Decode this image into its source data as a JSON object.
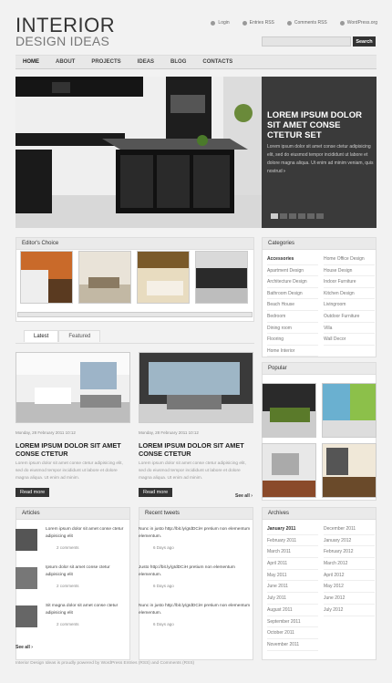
{
  "logo": {
    "line1": "INTERIOR",
    "line2": "DESIGN IDEAS"
  },
  "toplinks": [
    "Login",
    "Entries RSS",
    "Comments RSS",
    "WordPress.org"
  ],
  "search": {
    "button": "Search",
    "placeholder": ""
  },
  "nav": [
    "HOME",
    "ABOUT",
    "PROJECTS",
    "IDEAS",
    "BLOG",
    "CONTACTS"
  ],
  "slider": {
    "title": "LOREM IPSUM DOLOR SIT AMET CONSE CTETUR SET",
    "text": "Lorem ipsum dolor sit amet conse ctetur adipisicing elit, sed do eiusmod tempor incididunt ut labore et dolore magna aliqua. Ut enim ad minim veniam, quis nostrud",
    "more": "›"
  },
  "editors": {
    "title": "Editor's Choice"
  },
  "tabs": [
    "Latest",
    "Featured"
  ],
  "posts": [
    {
      "meta": "Monday, 28 February 2011 10:12",
      "title": "LOREM IPSUM DOLOR SIT AMET CONSE CTETUR",
      "text": "Lorem ipsum dolor sit amet conse ctetur adipisicing elit, sed do eiusmod tempor incididunt ut labore et dolore magna aliqua. Ut enim ad minim.",
      "btn": "Read more"
    },
    {
      "meta": "Monday, 28 February 2011 10:12",
      "title": "LOREM IPSUM DOLOR SIT AMET CONSE CTETUR",
      "text": "Lorem ipsum dolor sit amet conse ctetur adipisicing elit, sed do eiusmod tempor incididunt ut labore et dolore magna aliqua. Ut enim ad minim.",
      "btn": "Read more"
    }
  ],
  "see_all": "See all ›",
  "see_all2": "See all ›",
  "articles": {
    "title": "Articles",
    "items": [
      {
        "title": "Lorem ipsum dolor sit amet conse ctetur adipisicing elit",
        "comments": "2 comments"
      },
      {
        "title": "Ipsum dolor sit amet conse ctetur adipisicing elit",
        "comments": "2 comments"
      },
      {
        "title": "Sit magna dolor sit amet conse ctetur adipisicing elit",
        "comments": "2 comments"
      }
    ]
  },
  "tweets": {
    "title": "Recent tweets",
    "items": [
      {
        "text": "Nunc in justo http://bit.ly/gIdDCiH pretium non elementum elementum.",
        "ago": "6 Days ago"
      },
      {
        "text": "Justo http://bit.ly/gIdDCiH pretium non elementum elementum.",
        "ago": "6 Days ago"
      },
      {
        "text": "Nunc in justo http://bit.ly/gIdDCiH pretium non elementum elementum.",
        "ago": "6 Days ago"
      }
    ]
  },
  "categories": {
    "title": "Categories",
    "col1": [
      "Accessories",
      "Apartment Design",
      "Architecture Design",
      "Bathroom Design",
      "Beach House",
      "Bedroom",
      "Dining room",
      "Flooring",
      "Home Interior"
    ],
    "col2": [
      "Home Office Design",
      "House Design",
      "Indoor Furniture",
      "Kitchen Design",
      "Livingroom",
      "Outdoor Furniture",
      "Villa",
      "Wall Decor"
    ]
  },
  "popular": {
    "title": "Popular"
  },
  "archives": {
    "title": "Archives",
    "col1": [
      "January 2011",
      "February 2011",
      "March 2011",
      "April 2011",
      "May 2011",
      "June 2011",
      "July 2011",
      "August 2011",
      "September 2011",
      "October 2011",
      "November 2011"
    ],
    "col2": [
      "December 2011",
      "January 2012",
      "February 2012",
      "March 2012",
      "April 2012",
      "May 2012",
      "June 2012",
      "July 2012"
    ]
  },
  "footer": "Interior Design Ideas is proudly powered by WordPress Entries (RSS) and Comments (RSS)",
  "colors": {
    "accent": "#333333",
    "caption_bg": "#3a3a3a"
  }
}
